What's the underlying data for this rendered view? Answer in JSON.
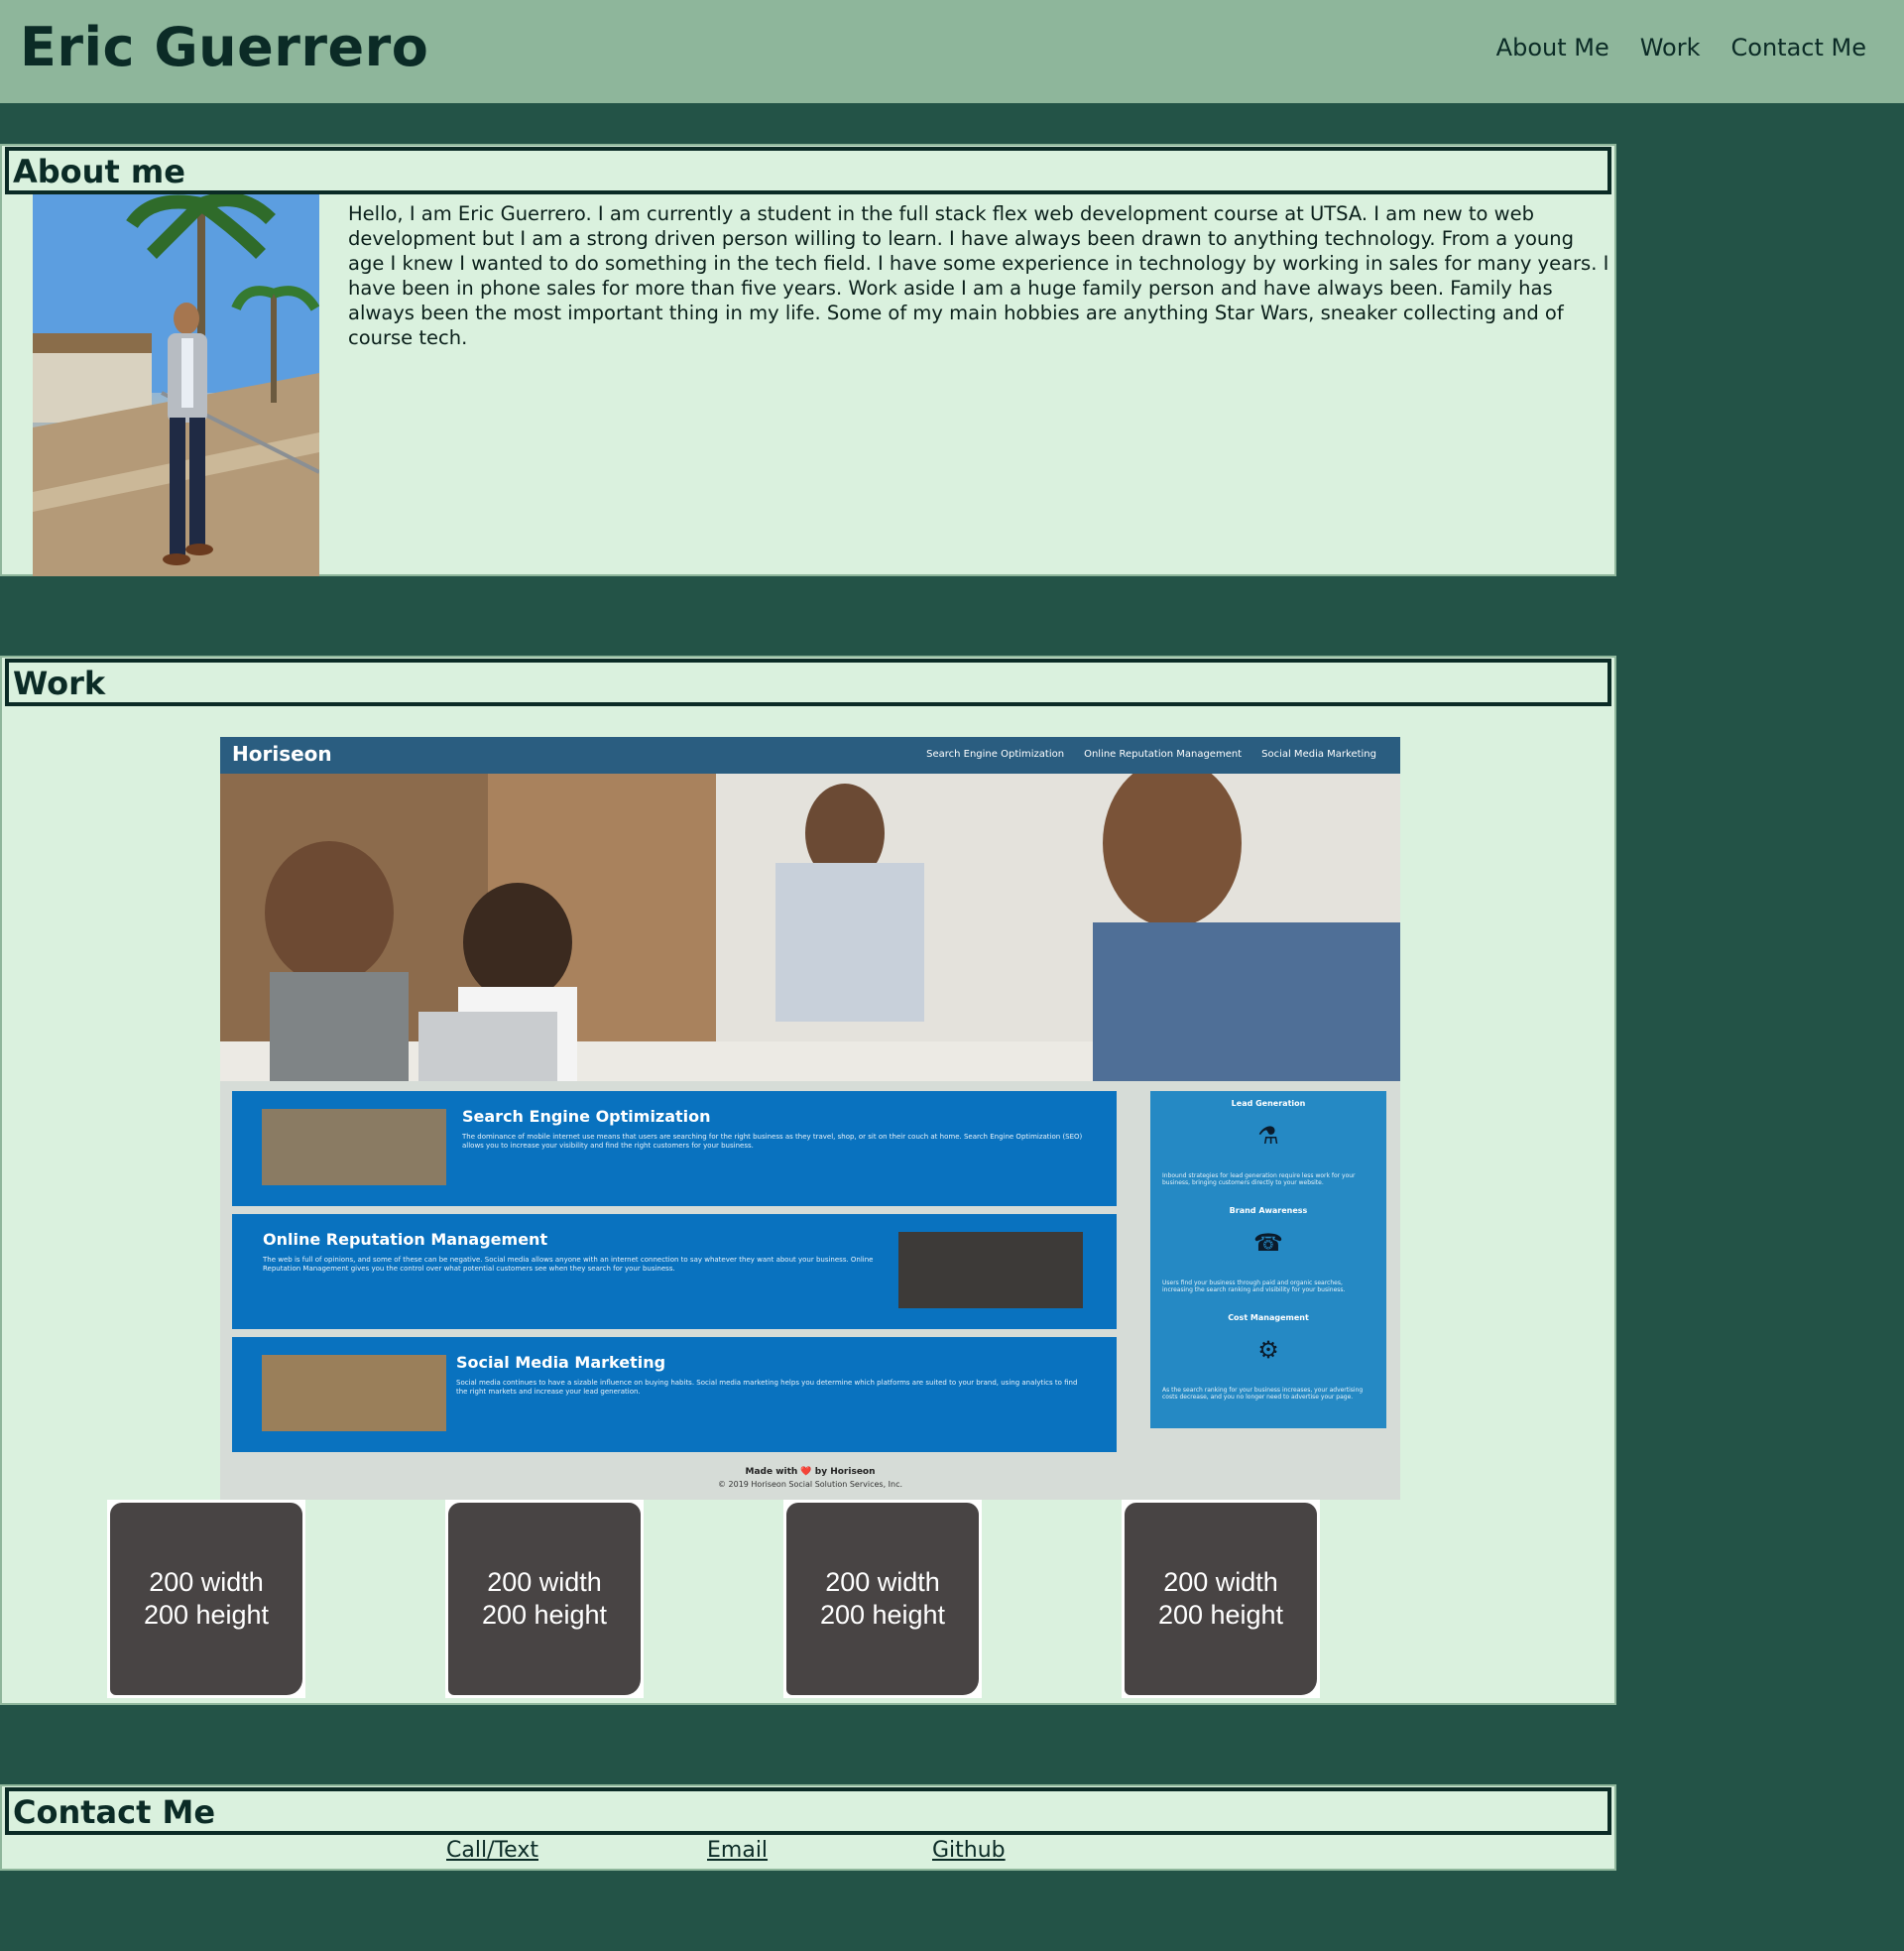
{
  "header": {
    "title": "Eric Guerrero",
    "nav": [
      "About Me",
      "Work",
      "Contact Me"
    ]
  },
  "about": {
    "heading": "About me",
    "text": "Hello, I am Eric Guerrero. I am currently a student in the full stack flex web development course at UTSA. I am new to web development but I am a strong driven person willing to learn. I have always been drawn to anything technology. From a young age I knew I wanted to do something in the tech field. I have some experience in technology by working in sales for many years. I have been in phone sales for more than five years. Work aside I am a huge family person and have always been. Family has always been the most important thing in my life. Some of my main hobbies are anything Star Wars, sneaker collecting and of course tech."
  },
  "work": {
    "heading": "Work",
    "project": {
      "brand": "Horiseon",
      "nav": [
        "Search Engine Optimization",
        "Online Reputation Management",
        "Social Media Marketing"
      ],
      "cards": [
        {
          "title": "Search Engine Optimization",
          "body": "The dominance of mobile internet use means that users are searching for the right business as they travel, shop, or sit on their couch at home. Search Engine Optimization (SEO) allows you to increase your visibility and find the right customers for your business."
        },
        {
          "title": "Online Reputation Management",
          "body": "The web is full of opinions, and some of these can be negative. Social media allows anyone with an internet connection to say whatever they want about your business. Online Reputation Management gives you the control over what potential customers see when they search for your business."
        },
        {
          "title": "Social Media Marketing",
          "body": "Social media continues to have a sizable influence on buying habits. Social media marketing helps you determine which platforms are suited to your brand, using analytics to find the right markets and increase your lead generation."
        }
      ],
      "aside": [
        {
          "title": "Lead Generation",
          "body": "Inbound strategies for lead generation require less work for your business, bringing customers directly to your website."
        },
        {
          "title": "Brand Awareness",
          "body": "Users find your business through paid and organic searches, increasing the search ranking and visibility for your business."
        },
        {
          "title": "Cost Management",
          "body": "As the search ranking for your business increases, your advertising costs decrease, and you no longer need to advertise your page."
        }
      ],
      "footer_line1": "Made with ❤️ by Horiseon",
      "footer_line2": "© 2019 Horiseon Social Solution Services, Inc."
    },
    "tiles": [
      {
        "line1": "200 width",
        "line2": "200 height"
      },
      {
        "line1": "200 width",
        "line2": "200 height"
      },
      {
        "line1": "200 width",
        "line2": "200 height"
      },
      {
        "line1": "200 width",
        "line2": "200 height"
      }
    ]
  },
  "contact": {
    "heading": "Contact Me",
    "links": [
      "Call/Text",
      "Email",
      "Github"
    ]
  },
  "colors": {
    "page_bg": "#235347",
    "header_bg": "#8eb69b",
    "section_bg": "#daf1de",
    "tile_bg": "#484444"
  }
}
